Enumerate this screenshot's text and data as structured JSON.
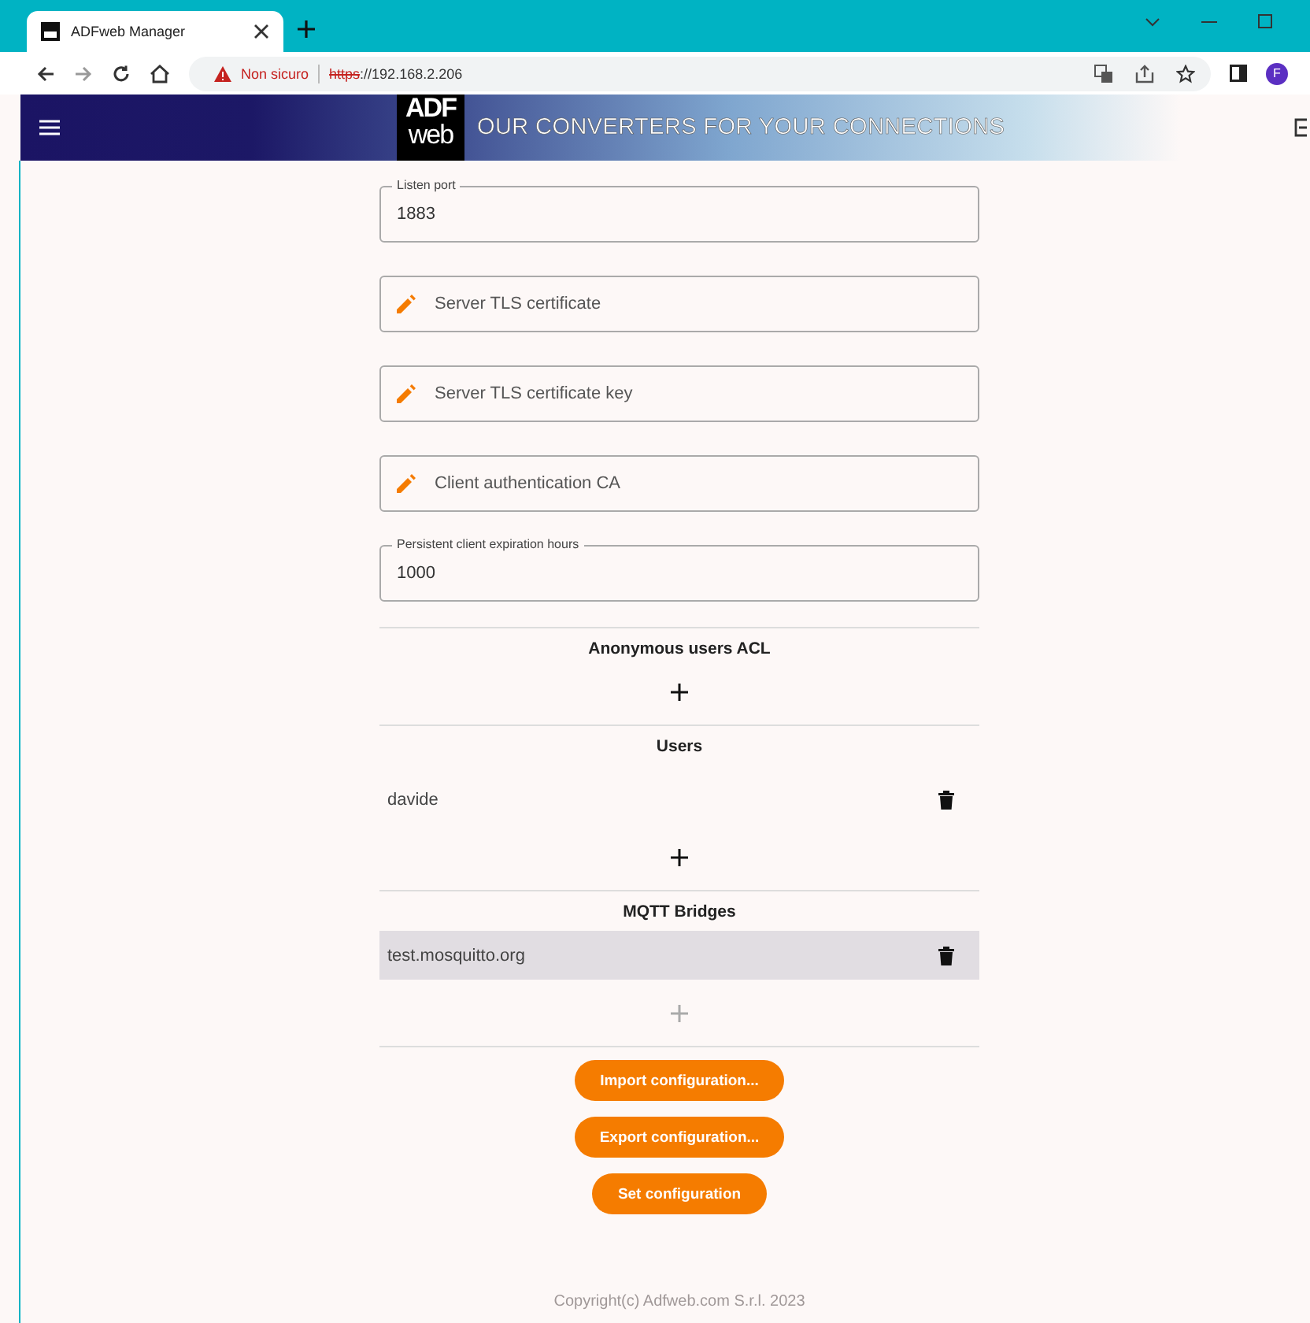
{
  "browser": {
    "tab_title": "ADFweb Manager",
    "security": "Non sicuro",
    "url_scheme": "https",
    "url_rest": "://192.168.2.206",
    "profile": "F"
  },
  "header": {
    "logo_top": "ADF",
    "logo_bottom": "web",
    "slogan": "OUR CONVERTERS FOR YOUR CONNECTIONS"
  },
  "fields": [
    {
      "kind": "text",
      "label": "Listen port",
      "value": "1883"
    },
    {
      "kind": "file",
      "label": "Server TLS certificate"
    },
    {
      "kind": "file",
      "label": "Server TLS certificate key"
    },
    {
      "kind": "file",
      "label": "Client authentication CA"
    },
    {
      "kind": "text",
      "label": "Persistent client expiration hours",
      "value": "1000"
    }
  ],
  "sections": [
    {
      "title": "Anonymous users ACL",
      "add_enabled": true
    },
    {
      "title": "Users",
      "items": [
        {
          "name": "davide",
          "selected": false
        }
      ],
      "add_enabled": true
    },
    {
      "title": "MQTT Bridges",
      "items": [
        {
          "name": "test.mosquitto.org",
          "selected": true
        }
      ],
      "add_enabled": false
    }
  ],
  "buttons": [
    "Import configuration...",
    "Export configuration...",
    "Set configuration"
  ],
  "footer": "Copyright(c) Adfweb.com S.r.l. 2023"
}
